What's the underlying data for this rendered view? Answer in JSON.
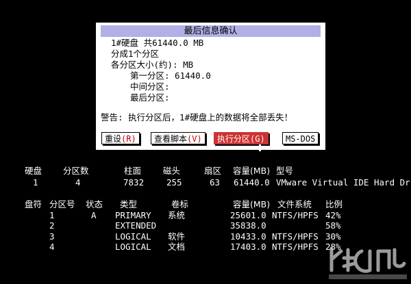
{
  "dialog": {
    "title": "最后信息确认",
    "disk_line": "1#硬盘 共61440.0 MB",
    "partition_count_line": "分成1个分区",
    "size_header": "各分区大小(约): MB",
    "first_partition": "第一分区: 61440.0",
    "middle_partition": "中间分区:",
    "last_partition": "最后分区:",
    "warning": "警告: 执行分区后，1#硬盘上的数据将全部丢失！",
    "buttons": [
      {
        "label": "重设",
        "hotkey": "(R)",
        "active": false
      },
      {
        "label": "查看脚本",
        "hotkey": "(V)",
        "active": false
      },
      {
        "label": "执行分区",
        "hotkey": "(G)",
        "active": true
      },
      {
        "label": "MS-DOS",
        "hotkey": "",
        "active": false
      }
    ]
  },
  "disk_table": {
    "headers": [
      "硬盘",
      "分区数",
      "柱面",
      "磁头",
      "扇区",
      "容量(MB)",
      "型号"
    ],
    "row": [
      "1",
      "4",
      "7832",
      "255",
      "63",
      "61440.0",
      "VMware Virtual IDE Hard Dr"
    ]
  },
  "partition_table": {
    "headers": [
      "盘符",
      "分区号",
      "状态",
      "类型",
      "卷标",
      "容量(MB)",
      "文件系统",
      "比例"
    ],
    "rows": [
      [
        "",
        "1",
        "A",
        "PRIMARY",
        "系统",
        "25601.0",
        "NTFS/HPFS",
        "42%"
      ],
      [
        "",
        "2",
        "",
        "EXTENDED",
        "",
        "35838.0",
        "",
        "58%"
      ],
      [
        "",
        "3",
        "",
        "LOGICAL",
        "软件",
        "10433.0",
        "NTFS/HPFS",
        "30%"
      ],
      [
        "",
        "4",
        "",
        "LOGICAL",
        "文档",
        "17403.0",
        "NTFS/HPFS",
        "28%"
      ]
    ]
  },
  "colors": {
    "dialog_title_bg": "#b0b0e6",
    "active_button": "#cc3333",
    "hotkey": "#c00000"
  }
}
